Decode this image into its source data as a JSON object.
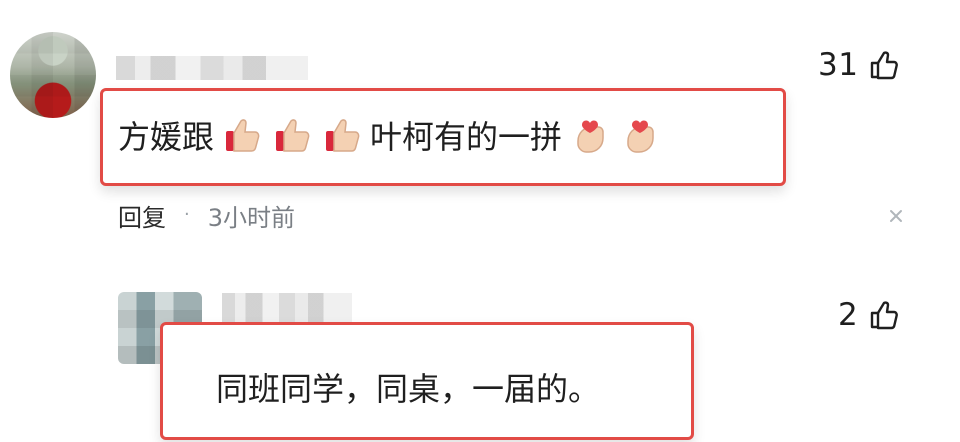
{
  "comments": [
    {
      "likes": "31",
      "text": {
        "before": "方媛跟",
        "after": "叶柯有的一拼"
      },
      "emojis_after_before": [
        "thumbs-up-emoji",
        "thumbs-up-emoji",
        "thumbs-up-emoji"
      ],
      "emojis_end": [
        "finger-heart-emoji",
        "finger-heart-emoji"
      ],
      "reply_label": "回复",
      "separator": "·",
      "time": "3小时前"
    },
    {
      "likes": "2",
      "text": "同班同学，同桌，一届的。"
    }
  ],
  "icons": {
    "like": "thumbs-up-outline-icon",
    "close": "close-icon"
  },
  "colors": {
    "highlight_border": "#e24b46",
    "text_primary": "#1f1f1f",
    "text_secondary": "#7a7f85"
  }
}
